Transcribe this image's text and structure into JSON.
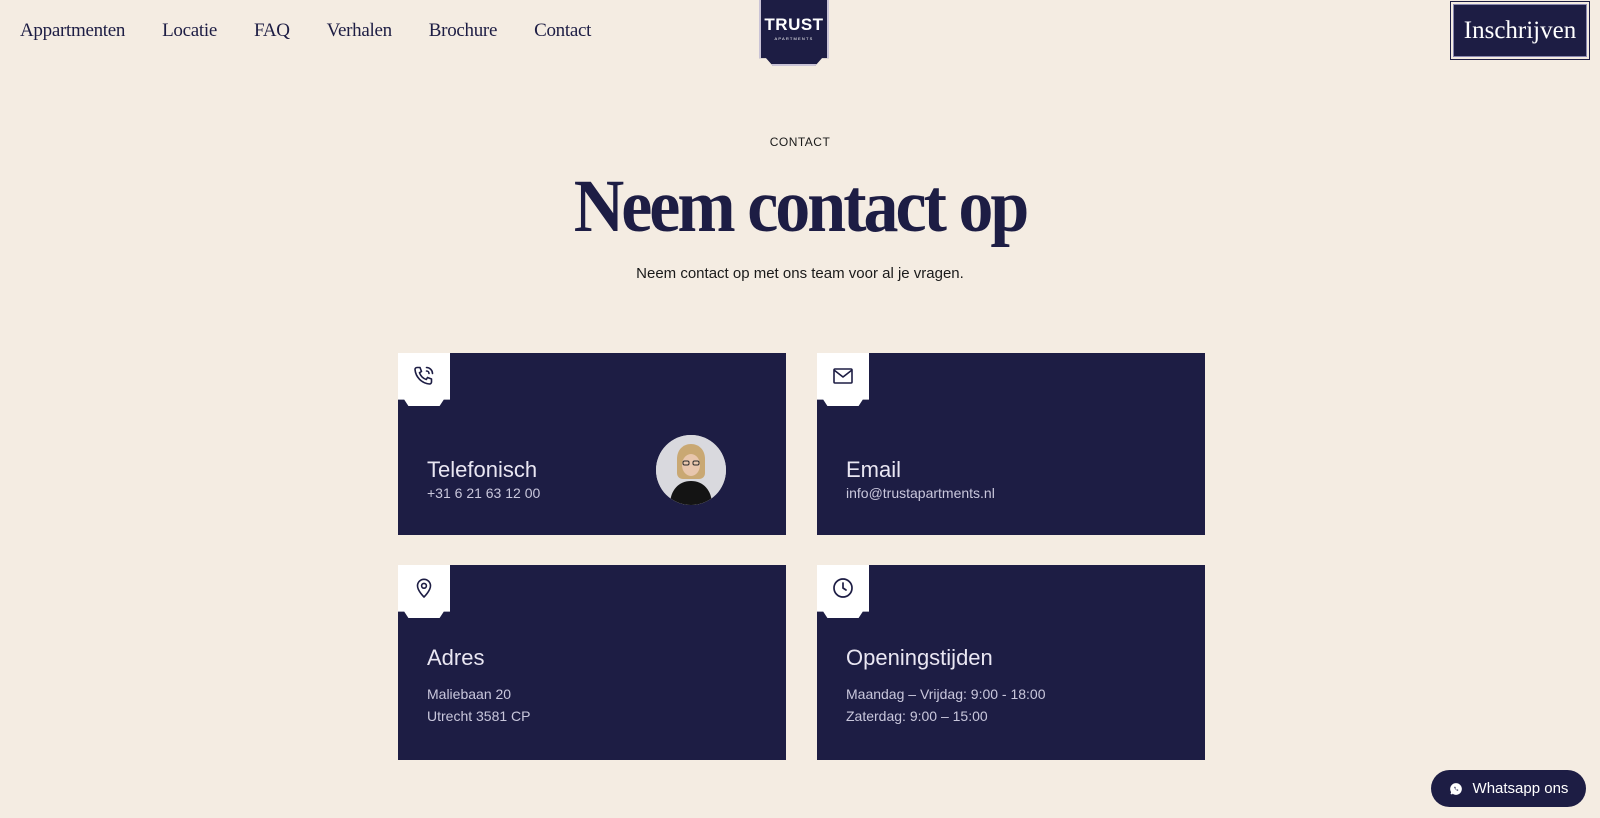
{
  "nav": {
    "items": [
      {
        "label": "Appartmenten"
      },
      {
        "label": "Locatie"
      },
      {
        "label": "FAQ"
      },
      {
        "label": "Verhalen"
      },
      {
        "label": "Brochure"
      },
      {
        "label": "Contact"
      }
    ],
    "logo": {
      "title": "TRUST",
      "subtitle": "APARTMENTS"
    },
    "cta_label": "Inschrijven"
  },
  "hero": {
    "eyebrow": "CONTACT",
    "title": "Neem contact op",
    "subtitle": "Neem contact op met ons team voor al je vragen."
  },
  "cards": {
    "phone": {
      "icon": "phone-icon",
      "title": "Telefonisch",
      "value": "+31 6 21 63 12 00"
    },
    "email": {
      "icon": "mail-icon",
      "title": "Email",
      "value": "info@trustapartments.nl"
    },
    "address": {
      "icon": "location-pin-icon",
      "title": "Adres",
      "lines": [
        "Maliebaan 20",
        "Utrecht 3581 CP"
      ]
    },
    "hours": {
      "icon": "clock-icon",
      "title": "Openingstijden",
      "lines": [
        "Maandag – Vrijdag: 9:00 - 18:00",
        "Zaterdag: 9:00 – 15:00"
      ]
    }
  },
  "whatsapp": {
    "icon": "whatsapp-icon",
    "label": "Whatsapp ons"
  },
  "colors": {
    "background": "#f4ece2",
    "navy": "#1d1d44",
    "white": "#ffffff"
  }
}
